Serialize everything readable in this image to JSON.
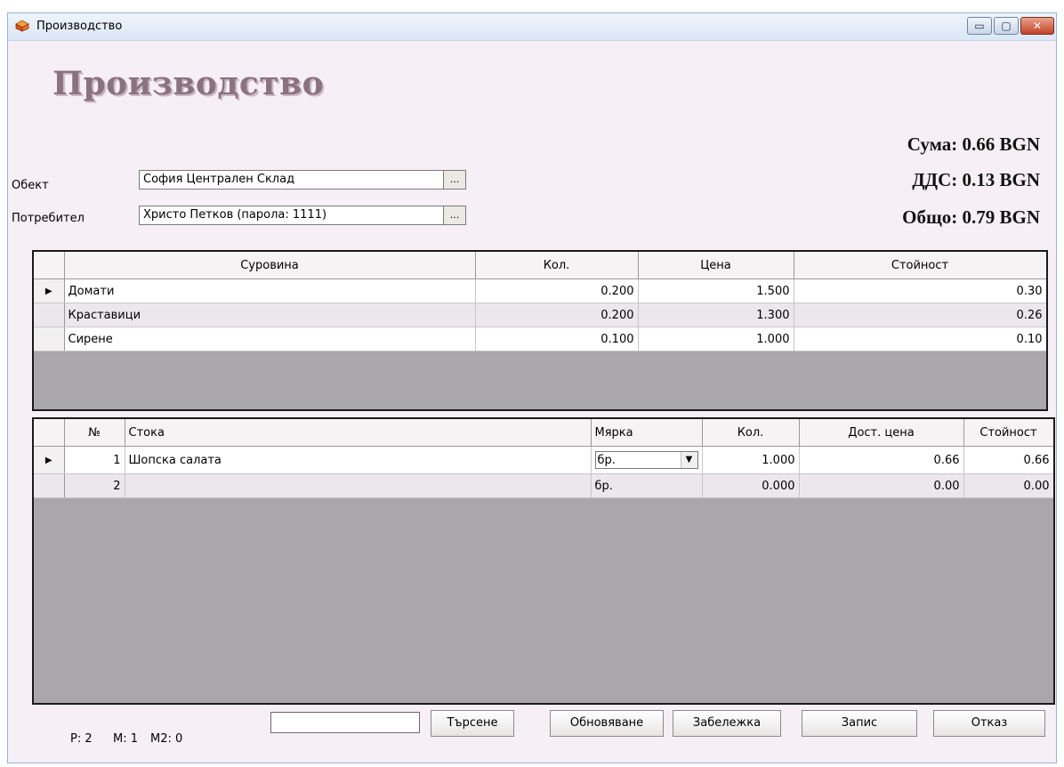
{
  "window": {
    "title": "Производство",
    "controls": {
      "minimize": "▭",
      "maximize": "▢",
      "close": "✕"
    }
  },
  "form": {
    "title": "Производство",
    "object_label": "Обект",
    "object_value": "София Централен Склад",
    "consumer_label": "Потребител",
    "consumer_value": "Христо Петков (парола: 1111)",
    "browse_label": "..."
  },
  "totals": {
    "sum": "Сума: 0.66 BGN",
    "vat": "ДДС: 0.13 BGN",
    "total": "Общо: 0.79 BGN"
  },
  "materials": {
    "headers": [
      "Суровина",
      "Кол.",
      "Цена",
      "Стойност"
    ],
    "rows": [
      {
        "indicator": "▶",
        "name": "Домати",
        "qty": "0.200",
        "price": "1.500",
        "value": "0.30"
      },
      {
        "indicator": "",
        "name": "Краставици",
        "qty": "0.200",
        "price": "1.300",
        "value": "0.26"
      },
      {
        "indicator": "",
        "name": "Сирене",
        "qty": "0.100",
        "price": "1.000",
        "value": "0.10"
      }
    ]
  },
  "products": {
    "headers": [
      "№",
      "Стока",
      "Мярка",
      "Кол.",
      "Дост. цена",
      "Стойност"
    ],
    "rows": [
      {
        "indicator": "▶",
        "no": "1",
        "name": "Шопска салата",
        "unit": "бр.",
        "qty": "1.000",
        "price": "0.66",
        "value": "0.66"
      },
      {
        "indicator": "",
        "no": "2",
        "name": "",
        "unit": "бр.",
        "qty": "0.000",
        "price": "0.00",
        "value": "0.00"
      }
    ]
  },
  "status": {
    "p": "P: 2",
    "m": "M: 1",
    "m2": "M2: 0"
  },
  "buttons": {
    "search": "Търсене",
    "refresh": "Обновяване",
    "note": "Забележка",
    "save": "Запис",
    "cancel": "Отказ"
  },
  "colors": {
    "title_gray": "#8a7280",
    "grid_empty": "#aaa7ab",
    "form_bg": "#f6eff5"
  }
}
